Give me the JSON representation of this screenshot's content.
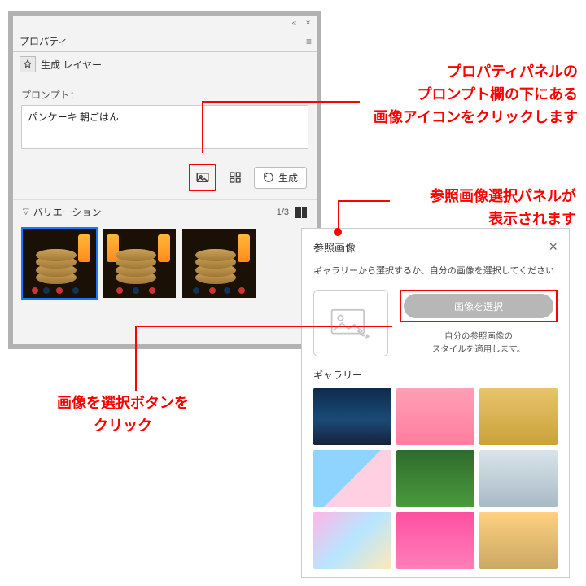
{
  "panel": {
    "tab": "プロパティ",
    "layer": "生成 レイヤー",
    "prompt_label": "プロンプト：",
    "prompt_value": "パンケーキ 朝ごはん",
    "generate_label": "生成",
    "variations_label": "バリエーション",
    "page_indicator": "1/3"
  },
  "ref": {
    "title": "参照画像",
    "desc": "ギャラリーから選択するか、自分の画像を選択してください",
    "select_btn": "画像を選択",
    "help1": "自分の参照画像の",
    "help2": "スタイルを適用します。",
    "gallery_label": "ギャラリー"
  },
  "anno": {
    "a1_l1": "プロパティパネルの",
    "a1_l2": "プロンプト欄の下にある",
    "a1_l3": "画像アイコンをクリックします",
    "a2_l1": "参照画像選択パネルが",
    "a2_l2": "表示されます",
    "a3_l1": "画像を選択ボタンを",
    "a3_l2": "クリック"
  },
  "gallery_colors": [
    "linear-gradient(#0d2b4a,#1a4a78 55%,#15223a)",
    "linear-gradient(#ff9fb6,#ff7d9e)",
    "linear-gradient(#e8c46a,#caa23a)",
    "linear-gradient(135deg,#8fd4ff 0 50%,#ffcfe2 50% 100%)",
    "linear-gradient(#2f6b2b,#4a9a3e)",
    "linear-gradient(#d9e4ea,#a9bac5)",
    "linear-gradient(135deg,#ffb6e6,#b6e6ff,#ffe9b6)",
    "linear-gradient(#ff4fa0,#ff7fba)",
    "linear-gradient(#ffd080,#caa864)"
  ]
}
